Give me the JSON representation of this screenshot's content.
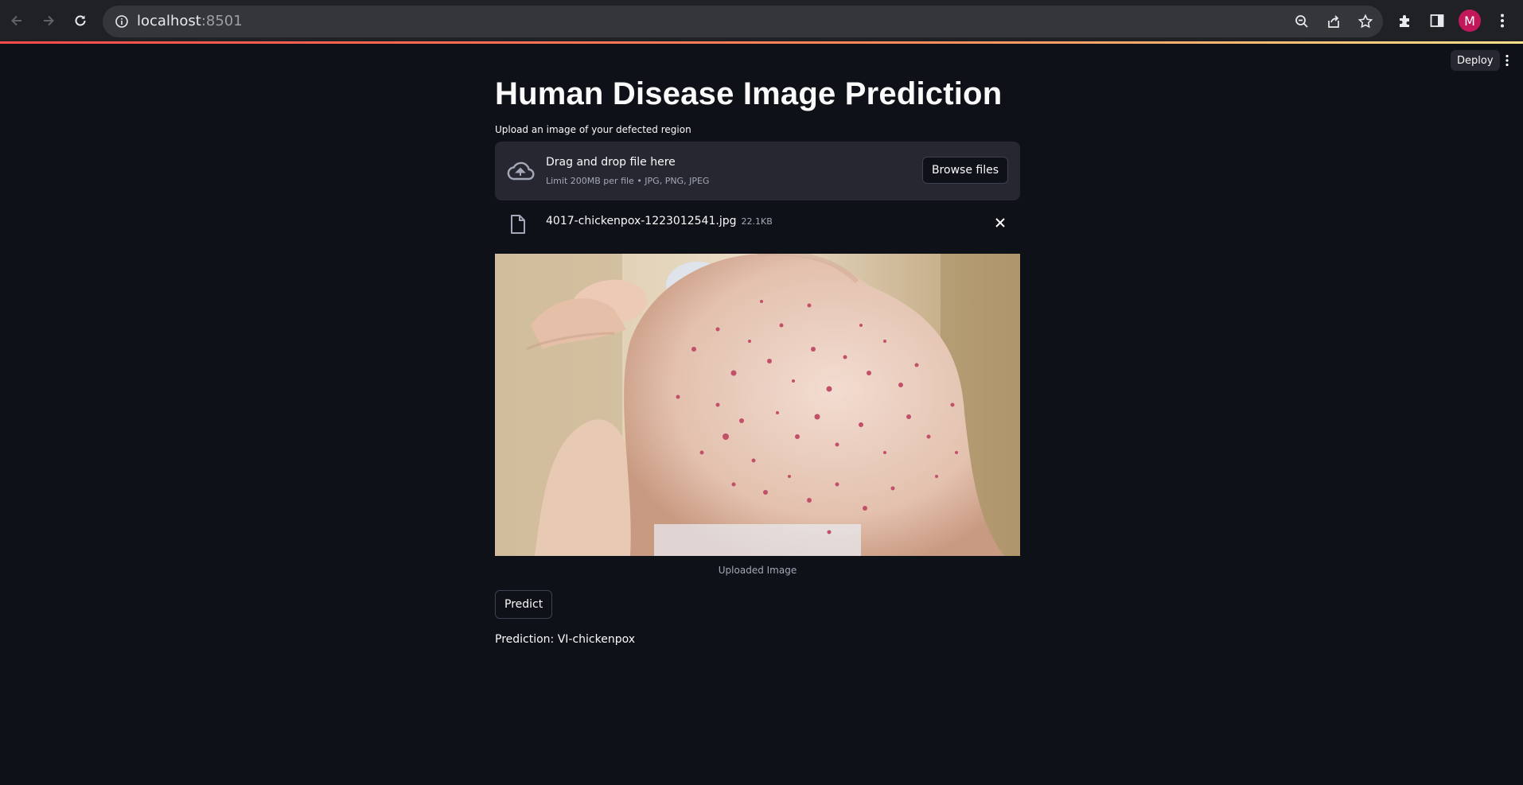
{
  "browser": {
    "url_host": "localhost",
    "url_port": ":8501",
    "avatar_initial": "M",
    "icons": {
      "back": "arrow-left-icon",
      "forward": "arrow-right-icon",
      "reload": "reload-icon",
      "site_info": "info-icon",
      "zoom": "zoom-out-icon",
      "share": "share-icon",
      "bookmark": "star-icon",
      "extensions": "puzzle-icon",
      "side_panel": "side-panel-icon",
      "menu": "vertical-dots-icon"
    }
  },
  "toolbar": {
    "deploy_label": "Deploy",
    "menu_icon": "vertical-dots-icon"
  },
  "page": {
    "title": "Human Disease Image Prediction",
    "uploader_label": "Upload an image of your defected region",
    "dropzone_title": "Drag and drop file here",
    "dropzone_limit": "Limit 200MB per file • JPG, PNG, JPEG",
    "browse_label": "Browse files",
    "uploaded_file": {
      "name": "4017-chickenpox-1223012541.jpg",
      "size": "22.1KB"
    },
    "image_caption": "Uploaded Image",
    "predict_label": "Predict",
    "prediction_text": "Prediction: VI-chickenpox"
  },
  "colors": {
    "background": "#0e1117",
    "secondary_background": "#262730",
    "text": "#fafafa",
    "muted_text": "#a3a8b8",
    "accent": "#ff4b4b"
  }
}
